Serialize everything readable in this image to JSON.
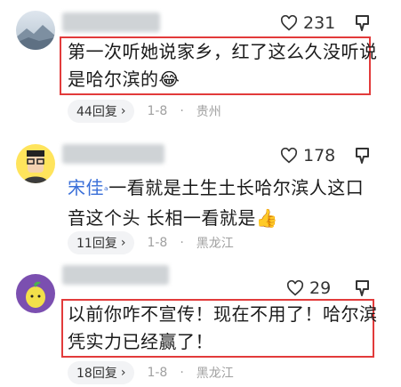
{
  "comments": [
    {
      "likes": "231",
      "text_lines": [
        "第一次听她说家乡，红了这么久没听说",
        "是哈尔滨的"
      ],
      "emoji": "😂",
      "replies": "44回复",
      "date": "1-8",
      "location": "贵州"
    },
    {
      "likes": "178",
      "mention": "宋佳",
      "text_part1": "一看就是土生土长哈尔滨人这口",
      "text_line2": "音这个头 长相一看就是",
      "emoji": "👍",
      "replies": "11回复",
      "date": "1-8",
      "location": "黑龙江"
    },
    {
      "likes": "29",
      "text_lines": [
        "以前你咋不宣传！现在不用了！哈尔滨",
        "凭实力已经赢了！"
      ],
      "replies": "18回复",
      "date": "1-8",
      "location": "黑龙江"
    }
  ],
  "colors": {
    "highlight": "#e23b3b",
    "mention": "#3a6fd8"
  },
  "icons": [
    "heart-icon",
    "dislike-icon",
    "chevron-right-icon",
    "location-dot-icon"
  ]
}
